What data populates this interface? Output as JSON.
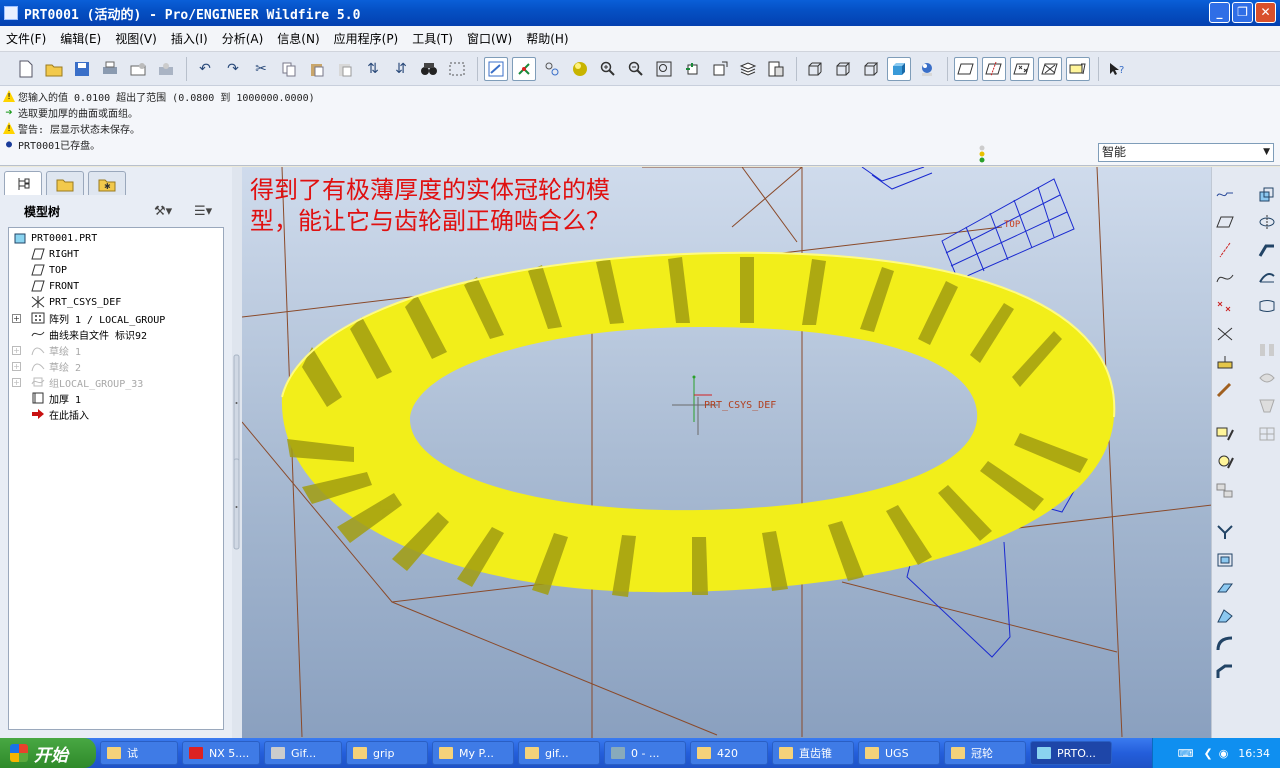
{
  "window": {
    "title": "PRT0001 (活动的) - Pro/ENGINEER Wildfire 5.0",
    "buttons": [
      "_",
      "❐",
      "✕"
    ]
  },
  "menubar": [
    "文件(F)",
    "编辑(E)",
    "视图(V)",
    "插入(I)",
    "分析(A)",
    "信息(N)",
    "应用程序(P)",
    "工具(T)",
    "窗口(W)",
    "帮助(H)"
  ],
  "messages": [
    {
      "type": "warning",
      "text": "您输入的值 0.0100 超出了范围 (0.0800 到 1000000.0000)"
    },
    {
      "type": "prompt",
      "text": "选取要加厚的曲面或面组。"
    },
    {
      "type": "warning",
      "text": "警告: 层显示状态未保存。"
    },
    {
      "type": "info",
      "text": "PRT0001已存盘。"
    }
  ],
  "filter": {
    "value": "智能"
  },
  "model_tree": {
    "title": "模型树",
    "items": [
      {
        "label": "PRT0001.PRT",
        "icon": "part-icon",
        "state": "normal"
      },
      {
        "label": "RIGHT",
        "icon": "datum-plane-icon",
        "state": "normal"
      },
      {
        "label": "TOP",
        "icon": "datum-plane-icon",
        "state": "normal"
      },
      {
        "label": "FRONT",
        "icon": "datum-plane-icon",
        "state": "normal"
      },
      {
        "label": "PRT_CSYS_DEF",
        "icon": "csys-icon",
        "state": "normal"
      },
      {
        "label": "阵列 1 / LOCAL_GROUP",
        "icon": "pattern-icon",
        "state": "normal"
      },
      {
        "label": "曲线来自文件 标识92",
        "icon": "curve-icon",
        "state": "normal"
      },
      {
        "label": "草绘 1",
        "icon": "sketch-icon",
        "state": "dim"
      },
      {
        "label": "草绘 2",
        "icon": "sketch-icon",
        "state": "dim"
      },
      {
        "label": "组LOCAL_GROUP_33",
        "icon": "group-icon",
        "state": "dim"
      },
      {
        "label": "加厚 1",
        "icon": "thicken-icon",
        "state": "normal"
      },
      {
        "label": "在此插入",
        "icon": "insert-here-icon",
        "state": "normal"
      }
    ]
  },
  "viewport": {
    "annotation": "得到了有极薄厚度的实体冠轮的模型，能让它与齿轮副正确啮合么？",
    "csys_label": "PRT_CSYS_DEF",
    "plane_label": "TOP",
    "colors": {
      "gear": "#f2ee1a",
      "gear_shade": "#a29e10",
      "annotation": "#e01010"
    }
  },
  "taskbar": {
    "start_label": "开始",
    "tasks": [
      "试",
      "NX 5....",
      "Gif...",
      "grip",
      "My P...",
      "gif...",
      "0 - ...",
      "420",
      "直齿锥",
      "UGS",
      "冠轮",
      "PRTO..."
    ],
    "clock": "16:34"
  }
}
